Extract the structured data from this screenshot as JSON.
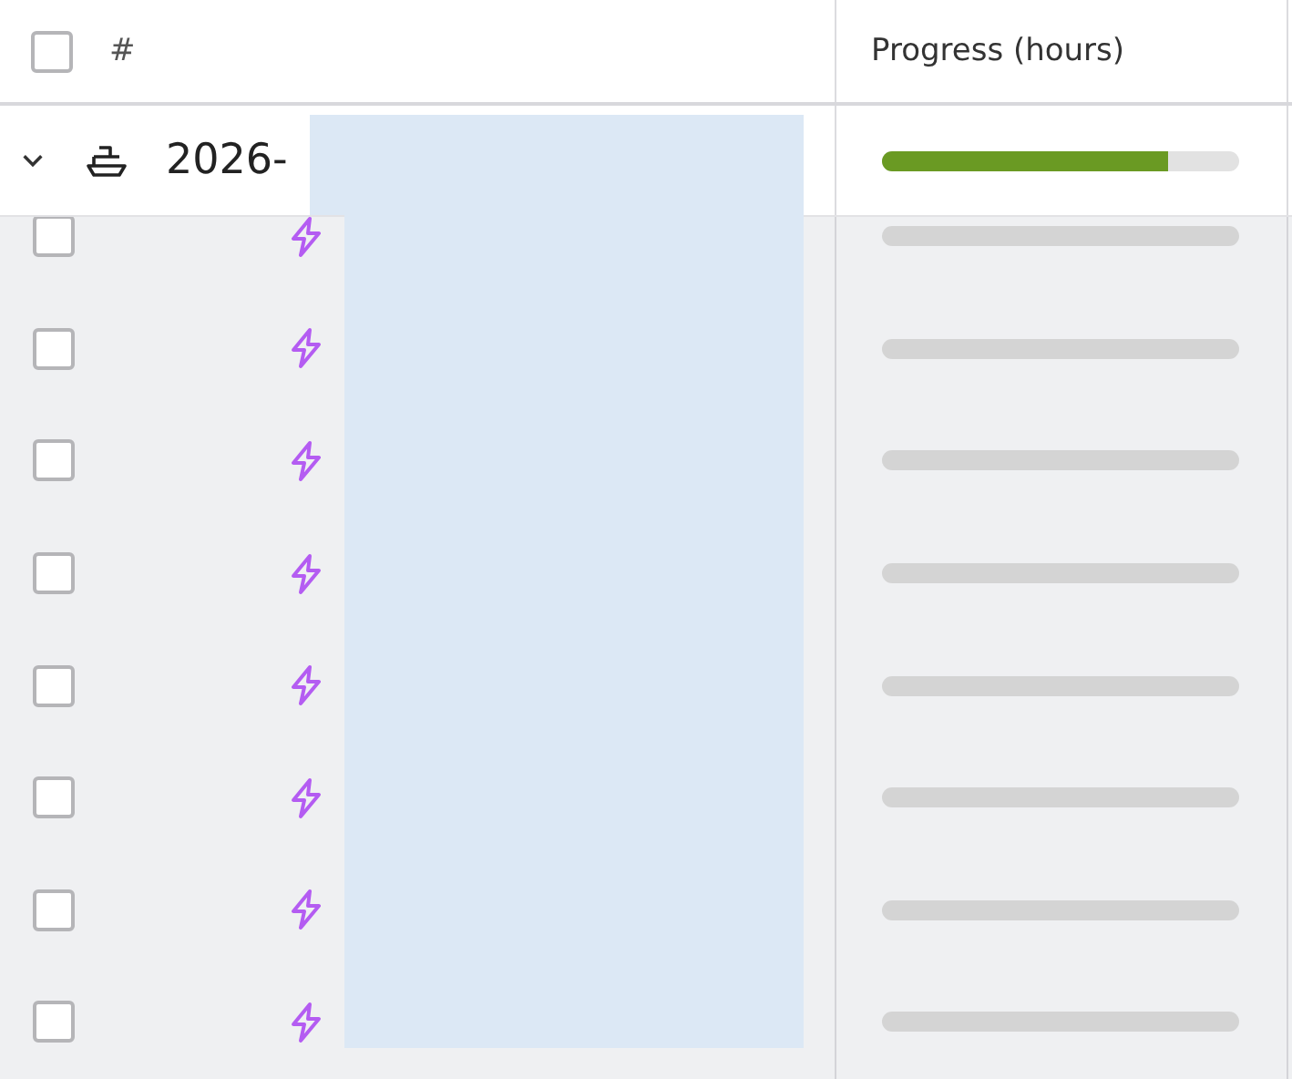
{
  "header": {
    "checked": false,
    "columns": [
      "#",
      "Progress (hours)"
    ]
  },
  "group": {
    "expanded": true,
    "title": "2026-",
    "level": 0.8
  },
  "rows": [
    {
      "checked": false,
      "level": 0
    },
    {
      "checked": false,
      "level": 0
    },
    {
      "checked": false,
      "level": 0
    },
    {
      "checked": false,
      "level": 0
    },
    {
      "checked": false,
      "level": 0
    },
    {
      "checked": false,
      "level": 0
    },
    {
      "checked": false,
      "level": 0
    },
    {
      "checked": false,
      "level": 0
    }
  ]
}
